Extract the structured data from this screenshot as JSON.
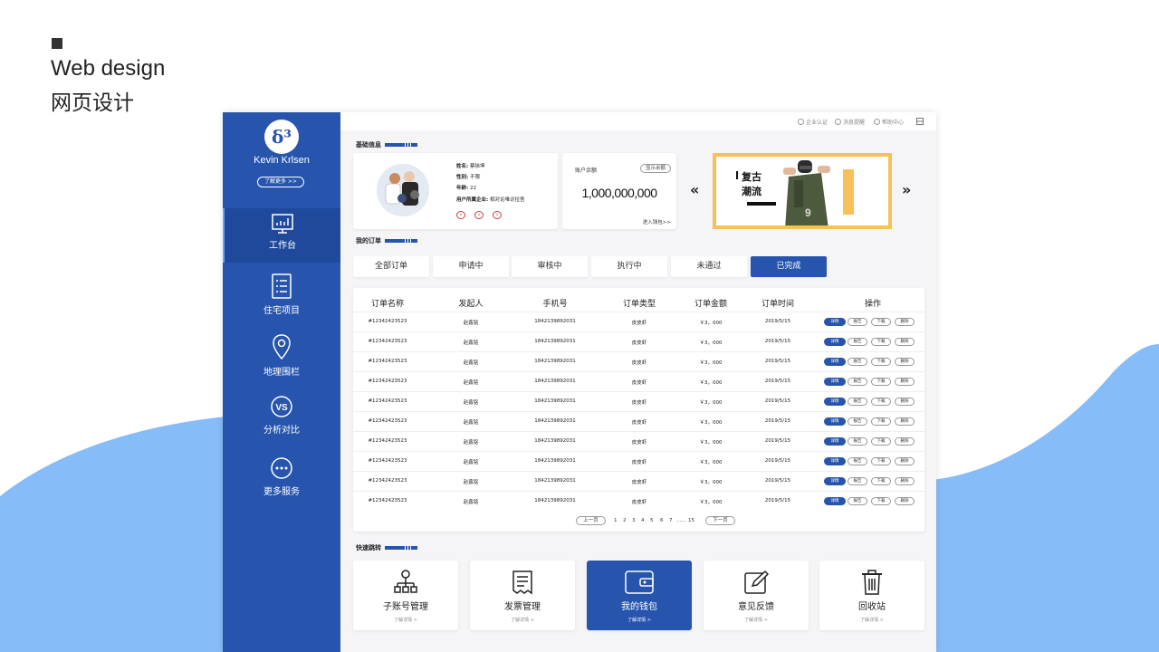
{
  "page": {
    "heading_en": "Web design",
    "heading_cn": "网页设计"
  },
  "colors": {
    "primary": "#2755ae",
    "wave": "#86bcf8",
    "banner_border": "#f6c15b"
  },
  "sidebar": {
    "user_name": "Kevin Krlsen",
    "more_label": "了解更多 >>",
    "items": [
      {
        "label": "工作台",
        "icon": "dashboard-chart-icon",
        "active": true
      },
      {
        "label": "住宅项目",
        "icon": "list-document-icon",
        "active": false
      },
      {
        "label": "地理围栏",
        "icon": "map-pin-icon",
        "active": false
      },
      {
        "label": "分析对比",
        "icon": "vs-compare-icon",
        "active": false
      },
      {
        "label": "更多服务",
        "icon": "more-dots-icon",
        "active": false
      }
    ]
  },
  "topbar": {
    "items": [
      "企业认证",
      "消息提醒",
      "帮助中心"
    ]
  },
  "basic_info": {
    "title": "基础信息",
    "name_label": "姓名:",
    "name_value": "蔡徐坤",
    "gender_label": "性别:",
    "gender_value": "不限",
    "age_label": "年龄:",
    "age_value": "22",
    "company_label": "用户所属企业:",
    "company_value": "相对论唯诊拉吾"
  },
  "balance": {
    "label": "账户余额",
    "show_button": "显示余额",
    "value": "1,000,000,000",
    "link": "进入钱包>>"
  },
  "banner": {
    "title_line1": "复古",
    "title_line2": "潮流"
  },
  "orders": {
    "title": "我的订单",
    "tabs": [
      {
        "label": "全部订单",
        "active": false
      },
      {
        "label": "申请中",
        "active": false
      },
      {
        "label": "审核中",
        "active": false
      },
      {
        "label": "执行中",
        "active": false
      },
      {
        "label": "未通过",
        "active": false
      },
      {
        "label": "已完成",
        "active": true
      }
    ],
    "columns": [
      "订单名称",
      "发起人",
      "手机号",
      "订单类型",
      "订单金额",
      "订单时间",
      "操作"
    ],
    "rows": [
      [
        "#12342423523",
        "赵鑫铭",
        "18421398920​31",
        "皮皮虾",
        "￥3，000",
        "2019/5/15"
      ],
      [
        "#12342423523",
        "赵鑫铭",
        "1842139892031",
        "皮皮虾",
        "￥3，000",
        "2019/5/15"
      ],
      [
        "#12342423523",
        "赵鑫铭",
        "1842139892031",
        "皮皮虾",
        "￥3，000",
        "2019/5/15"
      ],
      [
        "#12342423523",
        "赵鑫铭",
        "1842139892031",
        "皮皮虾",
        "￥3，000",
        "2019/5/15"
      ],
      [
        "#12342423523",
        "赵鑫铭",
        "1842139892031",
        "皮皮虾",
        "￥3，000",
        "2019/5/15"
      ],
      [
        "#12342423523",
        "赵鑫铭",
        "1842139892031",
        "皮皮虾",
        "￥3，000",
        "2019/5/15"
      ],
      [
        "#12342423523",
        "赵鑫铭",
        "1842139892031",
        "皮皮虾",
        "￥3，000",
        "2019/5/15"
      ],
      [
        "#12342423523",
        "赵鑫铭",
        "1842139892031",
        "皮皮虾",
        "￥3，000",
        "2019/5/15"
      ],
      [
        "#12342423523",
        "赵鑫铭",
        "1842139892031",
        "皮皮虾",
        "￥3，000",
        "2019/5/15"
      ],
      [
        "#12342423523",
        "赵鑫铭",
        "1842139892031",
        "皮皮虾",
        "￥3，000",
        "2019/5/15"
      ]
    ],
    "actions": [
      "详情",
      "报告",
      "下载",
      "删除"
    ],
    "pagination": {
      "prev": "上一页",
      "pages": [
        "1",
        "2",
        "3",
        "4",
        "5",
        "6",
        "7",
        "......",
        "15"
      ],
      "next": "下一页"
    }
  },
  "quick_jump": {
    "title": "快速跳转",
    "items": [
      {
        "label": "子账号管理",
        "sub": "了解详情 >",
        "icon": "org-chart-icon",
        "active": false
      },
      {
        "label": "发票管理",
        "sub": "了解详情 >",
        "icon": "receipt-icon",
        "active": false
      },
      {
        "label": "我的钱包",
        "sub": "了解详情 >",
        "icon": "wallet-icon",
        "active": true
      },
      {
        "label": "意见反馈",
        "sub": "了解详情 >",
        "icon": "edit-feedback-icon",
        "active": false
      },
      {
        "label": "回收站",
        "sub": "了解详情 >",
        "icon": "trash-icon",
        "active": false
      }
    ]
  }
}
